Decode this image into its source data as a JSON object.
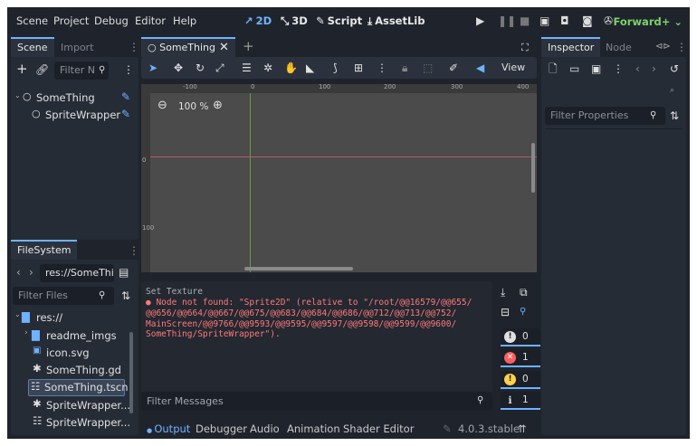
{
  "menu": [
    "Scene",
    "Project",
    "Debug",
    "Editor",
    "Help"
  ],
  "workspaces": [
    {
      "icon": "↗",
      "label": "2D"
    },
    {
      "icon": "⤡",
      "label": "3D"
    },
    {
      "icon": "✎",
      "label": "Script"
    },
    {
      "icon": "⤓",
      "label": "AssetLib"
    }
  ],
  "renderer": "Forward+ ⌄",
  "scene_dock": {
    "tabs": [
      "Scene",
      "Import"
    ],
    "filter_placeholder": "Filter N",
    "nodes": [
      "SomeThing",
      "SpriteWrapper"
    ]
  },
  "filesystem": {
    "tab": "FileSystem",
    "path": "res://SomeThi",
    "filter_placeholder": "Filter Files",
    "items": [
      "res://",
      "readme_imgs",
      "icon.svg",
      "SomeThing.gd",
      "SomeThing.tscn",
      "SpriteWrapper...",
      "SpriteWrapper..."
    ]
  },
  "editor": {
    "scene_tab": "SomeThing",
    "view_label": "View",
    "zoom": "100 %",
    "ruler_labels": [
      "-100",
      "0",
      "100",
      "200",
      "300",
      "400"
    ],
    "ruler_v_labels": [
      "0",
      "100"
    ]
  },
  "output": {
    "heading": "Set Texture",
    "lines": [
      "● Node not found: \"Sprite2D\" (relative to \"/root/@@16579/@@655/",
      "@@656/@@664/@@667/@@675/@@683/@@684/@@686/@@712/@@713/@@752/",
      "MainScreen/@@9766/@@9593/@@9595/@@9597/@@9598/@@9599/@@9600/",
      "SomeThing/SpriteWrapper\")."
    ],
    "filter_placeholder": "Filter Messages",
    "counts": {
      "errors": "0",
      "error_red": "1",
      "warnings": "0",
      "messages": "1"
    }
  },
  "bottom_tabs": [
    "Output",
    "Debugger",
    "Audio",
    "Animation",
    "Shader Editor"
  ],
  "version": "4.0.3.stable",
  "inspector": {
    "tabs": [
      "Inspector",
      "Node"
    ],
    "filter_placeholder": "Filter Properties"
  },
  "colors": {
    "accent": "#6fb2ff",
    "error": "#ff7a7a",
    "renderer": "#7ed36b"
  }
}
